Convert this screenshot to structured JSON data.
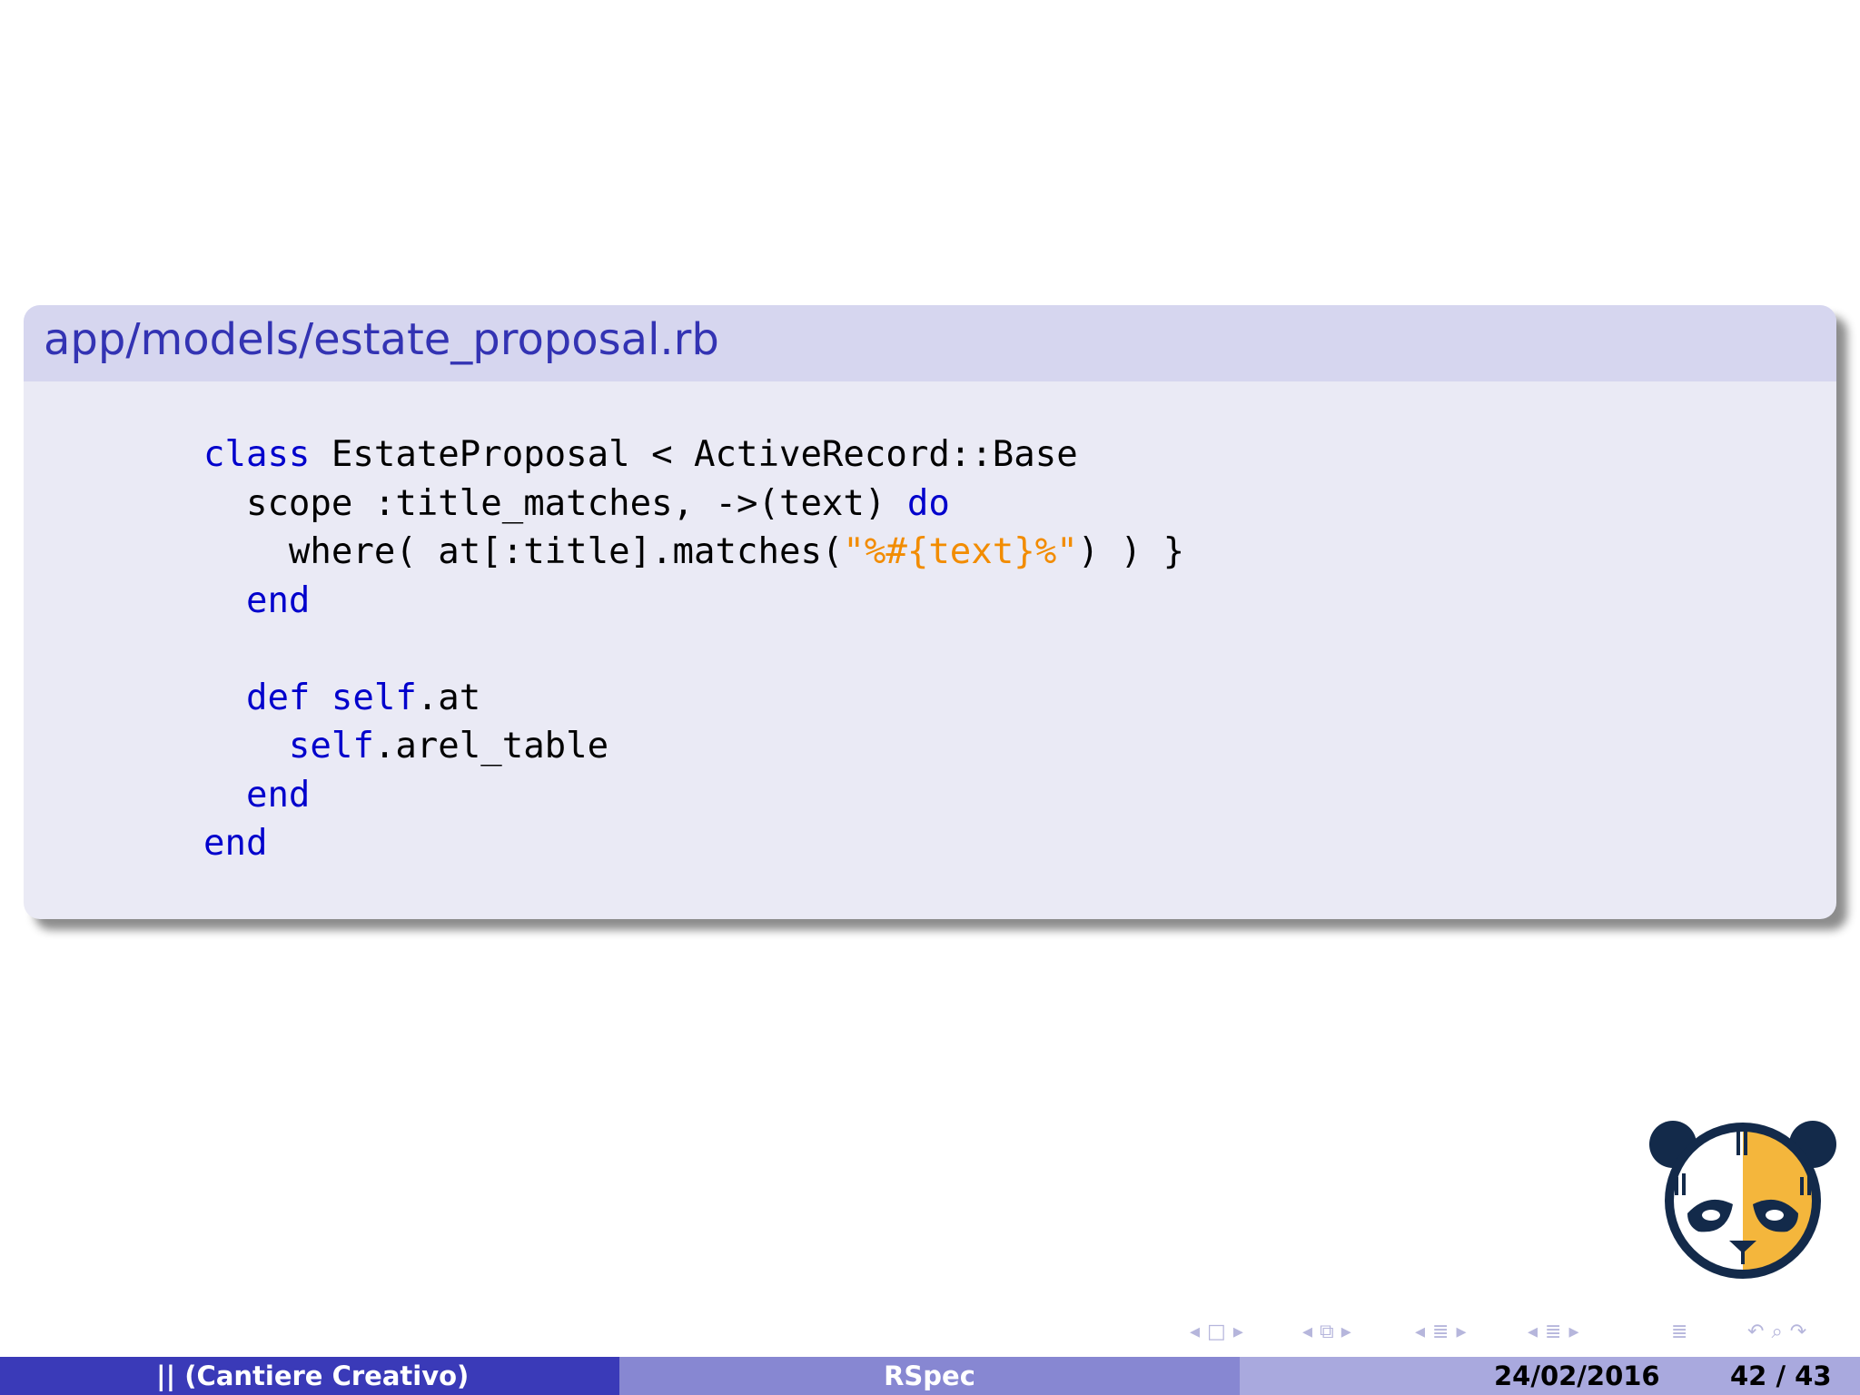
{
  "block": {
    "title": "app/models/estate_proposal.rb"
  },
  "code": {
    "l1_kw": "class",
    "l1_rest": " EstateProposal < ActiveRecord::Base",
    "l2_text": "  scope :title_matches, ->(text) ",
    "l2_kw": "do",
    "l3_pre": "    where( at[:title].matches(",
    "l3_str": "\"%#{text}%\"",
    "l3_post": ") ) }",
    "l4_kw": "  end",
    "l5": "",
    "l6_kw1": "  def",
    "l6_sp": " ",
    "l6_kw2": "self",
    "l6_rest": ".at",
    "l7_kw": "    self",
    "l7_rest": ".arel_table",
    "l8_kw": "  end",
    "l9_kw": "end"
  },
  "footer": {
    "author": "|| (Cantiere Creativo)",
    "title": "RSpec",
    "date": "24/02/2016",
    "page": "42 / 43"
  },
  "icons": {
    "logo": "panda-logo",
    "nav": [
      "slide-prev-icon",
      "slide-icon",
      "slide-next-icon",
      "frame-prev-icon",
      "frame-icon",
      "frame-next-icon",
      "subsection-prev-icon",
      "subsection-icon",
      "subsection-next-icon",
      "section-prev-icon",
      "section-icon",
      "section-next-icon",
      "document-icon",
      "undo-icon",
      "search-icon",
      "redo-icon"
    ]
  },
  "colors": {
    "keyword": "#0000cc",
    "string": "#f28c00",
    "block_title": "#3333b3",
    "footer_left": "#3a3ab8",
    "footer_mid": "#8787d2",
    "footer_right": "#a9a9de"
  }
}
